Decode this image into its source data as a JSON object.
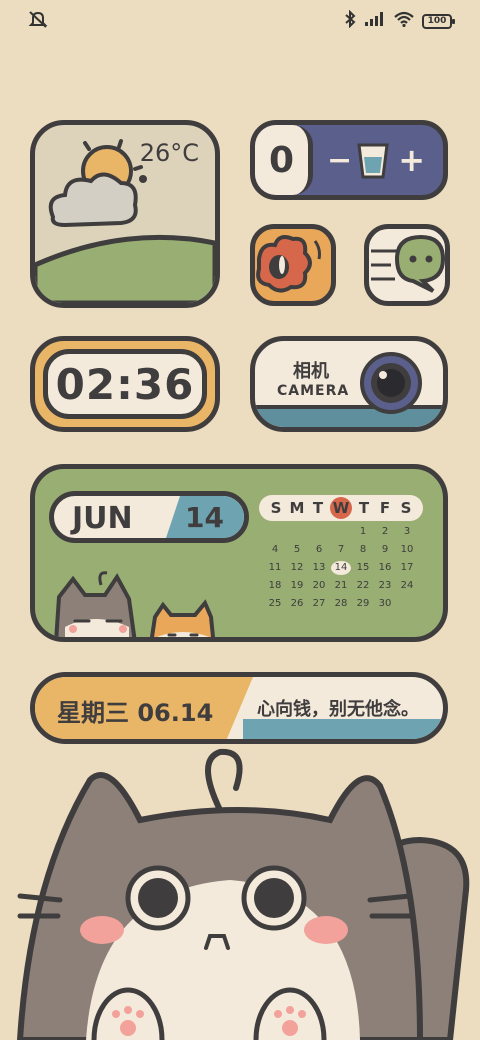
{
  "status_bar": {
    "battery": "100",
    "icons": [
      "mute-icon",
      "bluetooth-icon",
      "signal-icon",
      "wifi-icon",
      "battery-icon"
    ]
  },
  "weather": {
    "temperature": "26°C",
    "icon": "partly-cloudy-icon"
  },
  "water": {
    "count": "0",
    "minus": "−",
    "plus": "+"
  },
  "apps": [
    {
      "icon": "red-creature-app-icon"
    },
    {
      "icon": "green-chat-app-icon"
    }
  ],
  "clock": {
    "time": "02:36"
  },
  "camera": {
    "label_zh": "相机",
    "label_en": "CAMERA"
  },
  "calendar": {
    "month": "JUN",
    "day": "14",
    "weekdays": [
      "S",
      "M",
      "T",
      "W",
      "T",
      "F",
      "S"
    ],
    "today_weekday_index": 3,
    "weeks": [
      [
        "",
        "",
        "",
        "",
        "1",
        "2",
        "3"
      ],
      [
        "4",
        "5",
        "6",
        "7",
        "8",
        "9",
        "10"
      ],
      [
        "11",
        "12",
        "13",
        "14",
        "15",
        "16",
        "17"
      ],
      [
        "18",
        "19",
        "20",
        "21",
        "22",
        "23",
        "24"
      ],
      [
        "25",
        "26",
        "27",
        "28",
        "29",
        "30",
        ""
      ]
    ],
    "today": "14"
  },
  "quote": {
    "date": "星期三 06.14",
    "motto": "心向钱，别无他念。"
  },
  "colors": {
    "background": "#ecdcc0",
    "outline": "#3f3d3d",
    "cream": "#f4eadb",
    "green": "#98ae73",
    "orange": "#e9b567",
    "blue": "#6ea3b2",
    "navy": "#5a5f8c",
    "red": "#d6674a"
  }
}
